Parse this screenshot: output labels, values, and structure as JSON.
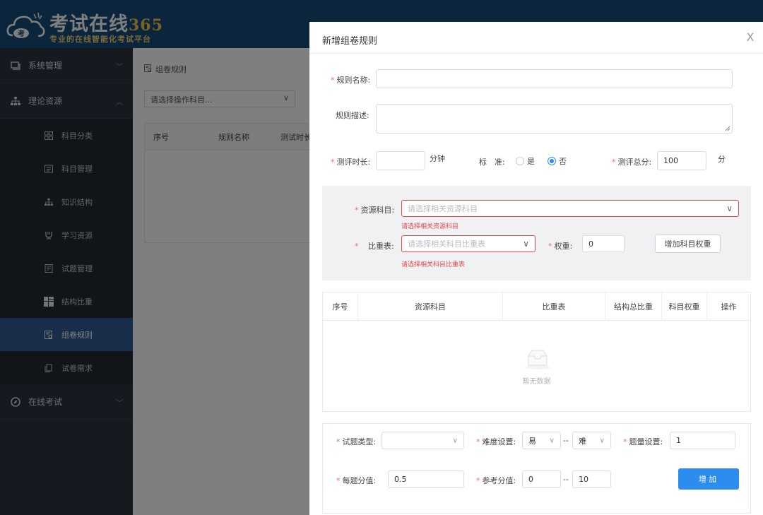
{
  "header": {
    "logo_title": "考试在线",
    "logo_number": "365",
    "logo_subtitle": "专业的在线智能化考试平台",
    "logo_badge": "考"
  },
  "sidebar": {
    "groups": [
      {
        "label": "系统管理",
        "expanded": false
      },
      {
        "label": "理论资源",
        "expanded": true
      },
      {
        "label": "在线考试",
        "expanded": false
      }
    ],
    "items": [
      {
        "label": "科目分类",
        "icon": "grid-icon"
      },
      {
        "label": "科目管理",
        "icon": "list-icon"
      },
      {
        "label": "知识结构",
        "icon": "tree-icon"
      },
      {
        "label": "学习资源",
        "icon": "cup-icon"
      },
      {
        "label": "试题管理",
        "icon": "doc-icon"
      },
      {
        "label": "结构比重",
        "icon": "blocks-icon"
      },
      {
        "label": "组卷规则",
        "icon": "rule-icon",
        "active": true
      },
      {
        "label": "试卷需求",
        "icon": "copy-icon"
      }
    ]
  },
  "main": {
    "breadcrumb": "组卷规则",
    "subject_select": "请选择操作科目...",
    "table_headers": [
      "序号",
      "规则名称",
      "测试时长"
    ]
  },
  "dialog": {
    "title": "新增组卷规则",
    "close": "X",
    "rule_name_label": "规则名称:",
    "rule_name_value": "",
    "rule_desc_label": "规则描述:",
    "rule_desc_value": "",
    "duration_label": "测评时长:",
    "duration_value": "",
    "duration_unit": "分钟",
    "standard_label": "标　准:",
    "standard_yes": "是",
    "standard_no": "否",
    "total_label": "测评总分:",
    "total_value": "100",
    "total_unit": "分",
    "resource_label": "资源科目:",
    "resource_placeholder": "请选择相关资源科目",
    "resource_error": "请选择相关资源科目",
    "ratio_label": "比重表:",
    "ratio_placeholder": "请选择相关科目比重表",
    "ratio_error": "请选择相关科目比重表",
    "weight_label": "权重:",
    "weight_value": "0",
    "add_weight_button": "增加科目权重",
    "table_headers": [
      "序号",
      "资源科目",
      "比重表",
      "结构总比重",
      "科目权重",
      "操作"
    ],
    "empty_text": "暂无数据",
    "qtype_label": "试题类型:",
    "qtype_value": "",
    "difficulty_label": "难度设置:",
    "difficulty_from": "易",
    "difficulty_sep": "--",
    "difficulty_to": "难",
    "count_label": "题量设置:",
    "count_value": "1",
    "score_each_label": "每题分值:",
    "score_each_value": "0.5",
    "ref_score_label": "参考分值:",
    "ref_score_from": "0",
    "ref_score_sep": "--",
    "ref_score_to": "10",
    "add_button": "增加"
  },
  "colors": {
    "header_bg": "#174a78",
    "sidebar_bg": "#2c3240",
    "active_menu": "#2f5a94",
    "primary": "#2d8cf0",
    "error": "#e34848"
  }
}
